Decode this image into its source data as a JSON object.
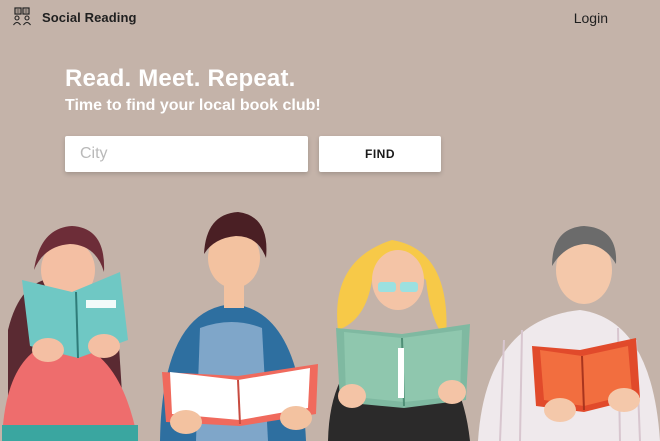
{
  "navbar": {
    "brand_icon": "book-club-icon",
    "brand_name": "Social Reading",
    "login_label": "Login"
  },
  "hero": {
    "title": "Read. Meet. Repeat.",
    "subtitle": "Time to find your local book club!"
  },
  "search": {
    "placeholder": "City",
    "value": "",
    "button_label": "FIND"
  },
  "illustration": {
    "description_icon": "people-reading-books-illustration",
    "readers": [
      "reader-woman-teal-book",
      "reader-man-red-book",
      "reader-woman-green-book",
      "reader-man-orange-book"
    ]
  },
  "colors": {
    "background": "#c4b3a9",
    "hero_text": "#ffffff",
    "input_bg": "#ffffff",
    "button_bg": "#ffffff"
  }
}
